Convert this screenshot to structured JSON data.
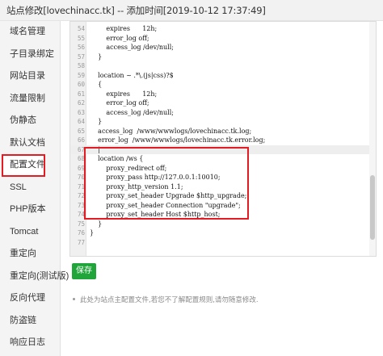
{
  "window": {
    "title": "站点修改[lovechinacc.tk] -- 添加时间[2019-10-12 17:37:49]"
  },
  "sidebar": {
    "items": [
      {
        "label": "域名管理"
      },
      {
        "label": "子目录绑定"
      },
      {
        "label": "网站目录"
      },
      {
        "label": "流量限制"
      },
      {
        "label": "伪静态"
      },
      {
        "label": "默认文档"
      },
      {
        "label": "配置文件",
        "active": true
      },
      {
        "label": "SSL"
      },
      {
        "label": "PHP版本"
      },
      {
        "label": "Tomcat"
      },
      {
        "label": "重定向"
      },
      {
        "label": "重定向(测试版)"
      },
      {
        "label": "反向代理"
      },
      {
        "label": "防盗链"
      },
      {
        "label": "响应日志"
      }
    ]
  },
  "editor": {
    "lines": [
      {
        "num": "54",
        "text": "        expires      12h;"
      },
      {
        "num": "55",
        "text": "        error_log off;"
      },
      {
        "num": "56",
        "text": "        access_log /dev/null;"
      },
      {
        "num": "57",
        "text": "    }"
      },
      {
        "num": "58",
        "text": ""
      },
      {
        "num": "59",
        "text": "    location ~ .*\\.(js|css)?$"
      },
      {
        "num": "60",
        "text": "    {"
      },
      {
        "num": "61",
        "text": "        expires      12h;"
      },
      {
        "num": "62",
        "text": "        error_log off;"
      },
      {
        "num": "63",
        "text": "        access_log /dev/null;"
      },
      {
        "num": "64",
        "text": "    }"
      },
      {
        "num": "65",
        "text": "    access_log  /www/wwwlogs/lovechinacc.tk.log;"
      },
      {
        "num": "66",
        "text": "    error_log  /www/wwwlogs/lovechinacc.tk.error.log;"
      },
      {
        "num": "67",
        "text": "    |"
      },
      {
        "num": "68",
        "text": "    location /ws {"
      },
      {
        "num": "69",
        "text": "        proxy_redirect off;"
      },
      {
        "num": "70",
        "text": "        proxy_pass http://127.0.0.1:10010;"
      },
      {
        "num": "71",
        "text": "        proxy_http_version 1.1;"
      },
      {
        "num": "72",
        "text": "        proxy_set_header Upgrade $http_upgrade;"
      },
      {
        "num": "73",
        "text": "        proxy_set_header Connection \"upgrade\";"
      },
      {
        "num": "74",
        "text": "        proxy_set_header Host $http_host;"
      },
      {
        "num": "75",
        "text": "    }"
      },
      {
        "num": "76",
        "text": "}"
      },
      {
        "num": "77",
        "text": ""
      }
    ]
  },
  "actions": {
    "save_label": "保存"
  },
  "note": {
    "text": "此处为站点主配置文件,若您不了解配置规则,请勿随意修改."
  },
  "colors": {
    "accent_green": "#20a53a",
    "highlight_red": "#e41b22"
  }
}
